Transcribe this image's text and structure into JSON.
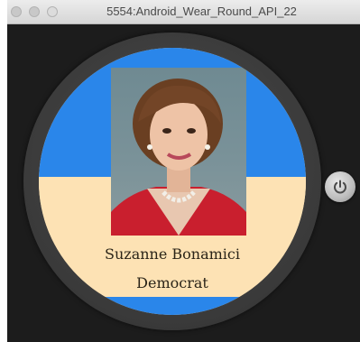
{
  "window": {
    "title": "5554:Android_Wear_Round_API_22"
  },
  "card": {
    "name": "Suzanne Bonamici",
    "party": "Democrat",
    "top_color": "#2a86ea",
    "bottom_color": "#fde2b4"
  },
  "controls": {
    "power_icon": "power-icon"
  }
}
